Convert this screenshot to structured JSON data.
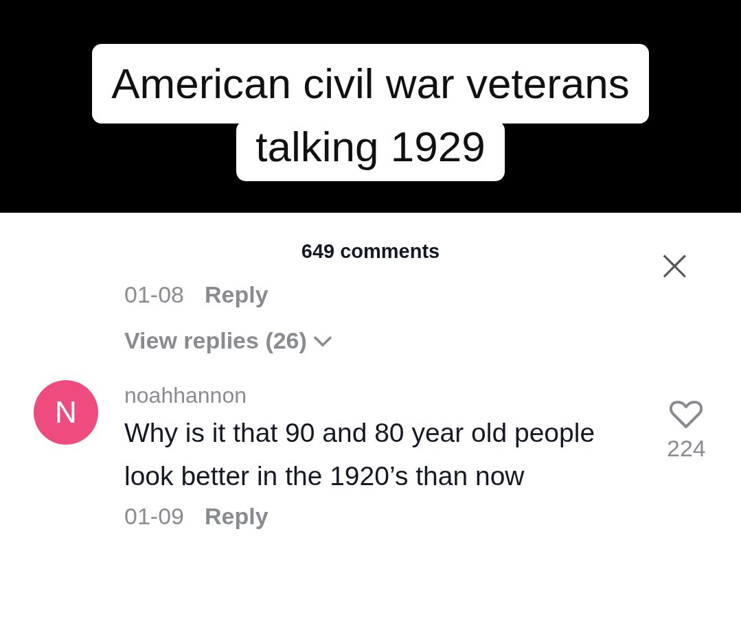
{
  "video": {
    "caption_lines": [
      "American civil war veterans",
      "talking 1929"
    ]
  },
  "comments_sheet": {
    "title": "649 comments",
    "close": "×",
    "partial_comment": {
      "date": "01-08",
      "reply": "Reply"
    },
    "view_replies": "View replies (26)",
    "comment": {
      "avatar_letter": "N",
      "color": "#ee4c7f",
      "username": "noahhannon",
      "text": "Why is it that 90 and 80 year old people look better in the 1920’s than now",
      "likes": "224",
      "liked": false,
      "date": "01-09",
      "reply": "Reply"
    }
  }
}
